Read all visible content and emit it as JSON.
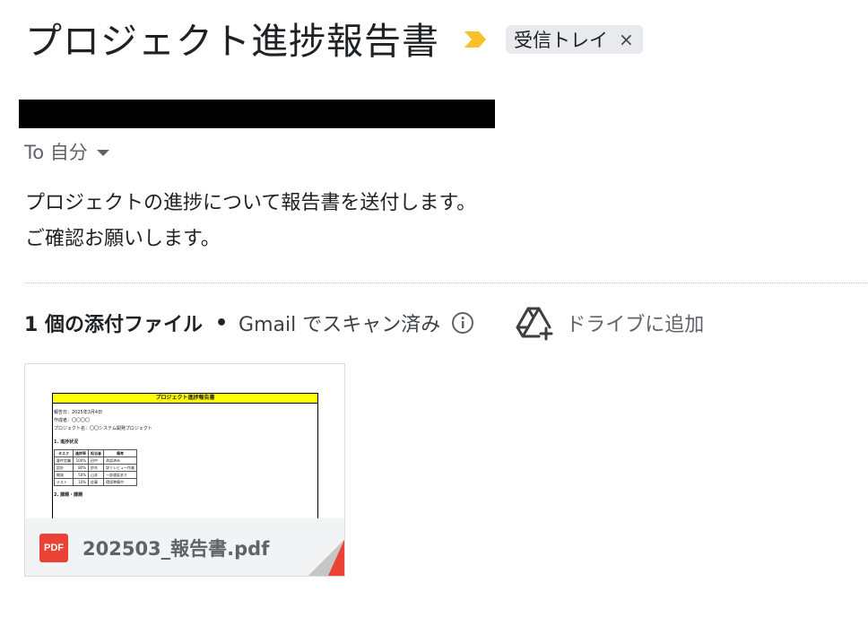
{
  "email": {
    "subject": "プロジェクト進捗報告書",
    "label_chip": {
      "text": "受信トレイ",
      "close_icon": "×"
    },
    "recipient": "To 自分",
    "body": "プロジェクトの進捗について報告書を送付します。\nご確認お願いします。"
  },
  "attachments": {
    "count_label": "1 個の添付ファイル",
    "separator": "•",
    "scan_text": "Gmail でスキャン済み",
    "drive_button_label": "ドライブに追加",
    "files": [
      {
        "name": "202503_報告書.pdf",
        "type_badge": "PDF",
        "preview": {
          "title": "プロジェクト進捗報告書",
          "lines": [
            "報告日：2025年3月4日",
            "作成者：〇〇〇〇",
            "プロジェクト名：〇〇システム開発プロジェクト"
          ],
          "section1": "1. 進捗状況",
          "table_headers": [
            "タスク",
            "進捗率",
            "担当者",
            "備考"
          ],
          "table_rows": [
            [
              "要件定義",
              "100%",
              "田中",
              "承認済み"
            ],
            [
              "設計",
              "80%",
              "鈴木",
              "詳リレビュー作業"
            ],
            [
              "開発",
              "50%",
              "山本",
              "一部遅延あり"
            ],
            [
              "テスト",
              "10%",
              "佐藤",
              "環境準備中"
            ]
          ],
          "section2": "2. 課題・課題"
        }
      }
    ]
  },
  "colors": {
    "importance_marker": "#f6c026",
    "pdf_red": "#ea4335",
    "chip_bg": "#e8eaed"
  },
  "icons": {
    "importance": "importance-marker-icon",
    "info": "info-icon",
    "drive": "drive-add-icon",
    "pdf": "pdf-icon"
  }
}
